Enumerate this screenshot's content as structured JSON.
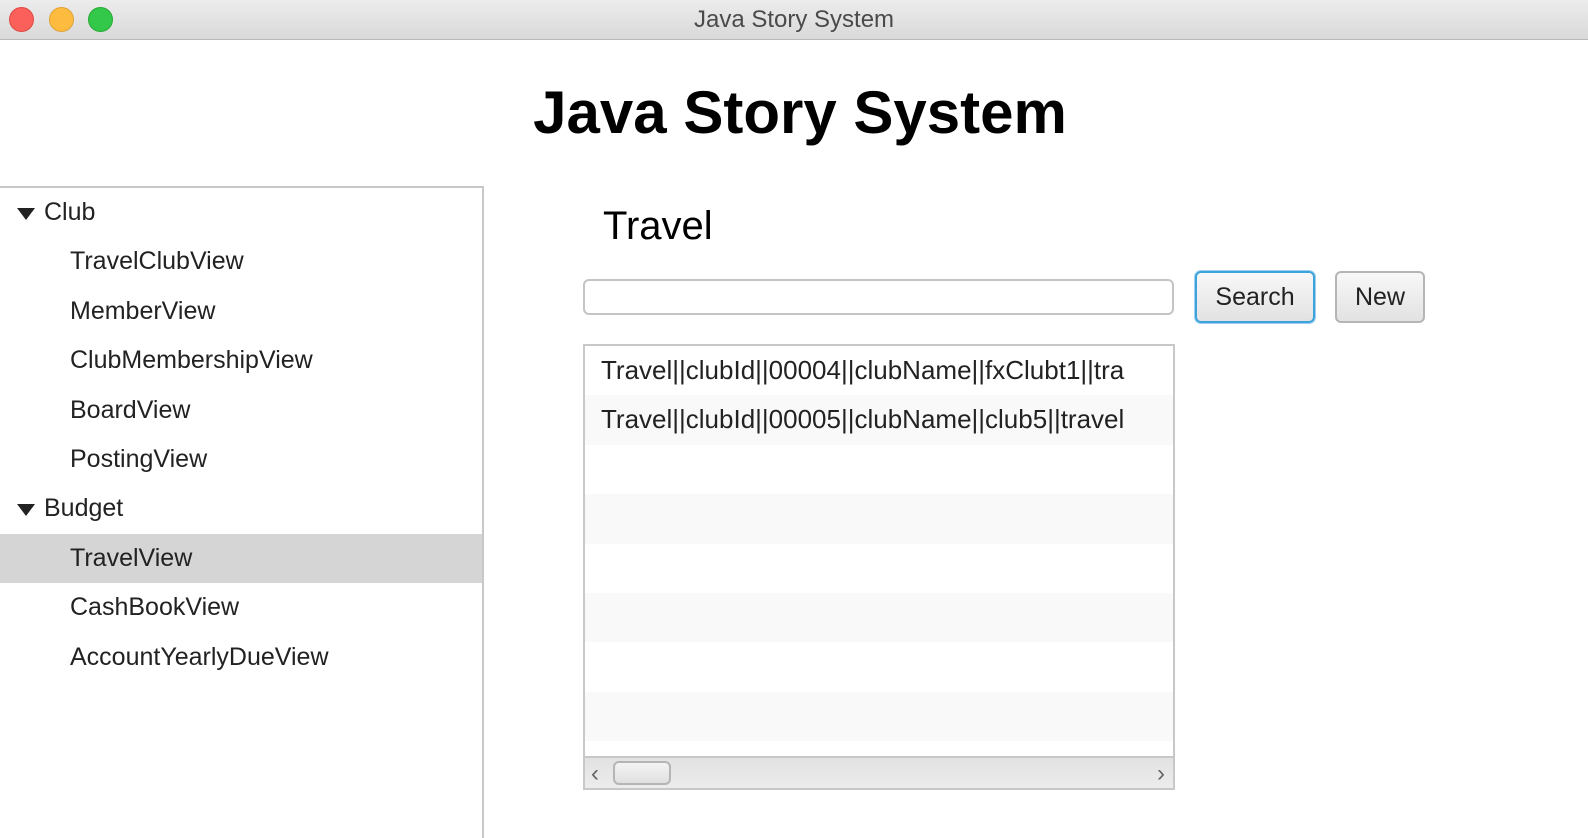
{
  "window": {
    "title": "Java Story System",
    "lights": {
      "close": "#fc605b",
      "minimize": "#fdbc40",
      "zoom": "#34c84a"
    }
  },
  "app": {
    "title": "Java Story System"
  },
  "tree": {
    "groups": [
      {
        "label": "Club",
        "items": [
          "TravelClubView",
          "MemberView",
          "ClubMembershipView",
          "BoardView",
          "PostingView"
        ]
      },
      {
        "label": "Budget",
        "items": [
          "TravelView",
          "CashBookView",
          "AccountYearlyDueView"
        ]
      }
    ],
    "selected": "TravelView"
  },
  "main": {
    "section_title": "Travel",
    "search": {
      "value": "",
      "placeholder": ""
    },
    "search_label": "Search",
    "new_label": "New",
    "list": [
      "Travel||clubId||00004||clubName||fxClubt1||tra",
      "Travel||clubId||00005||clubName||club5||travel"
    ],
    "scroll": {
      "left_icon": "‹",
      "right_icon": "›"
    }
  }
}
